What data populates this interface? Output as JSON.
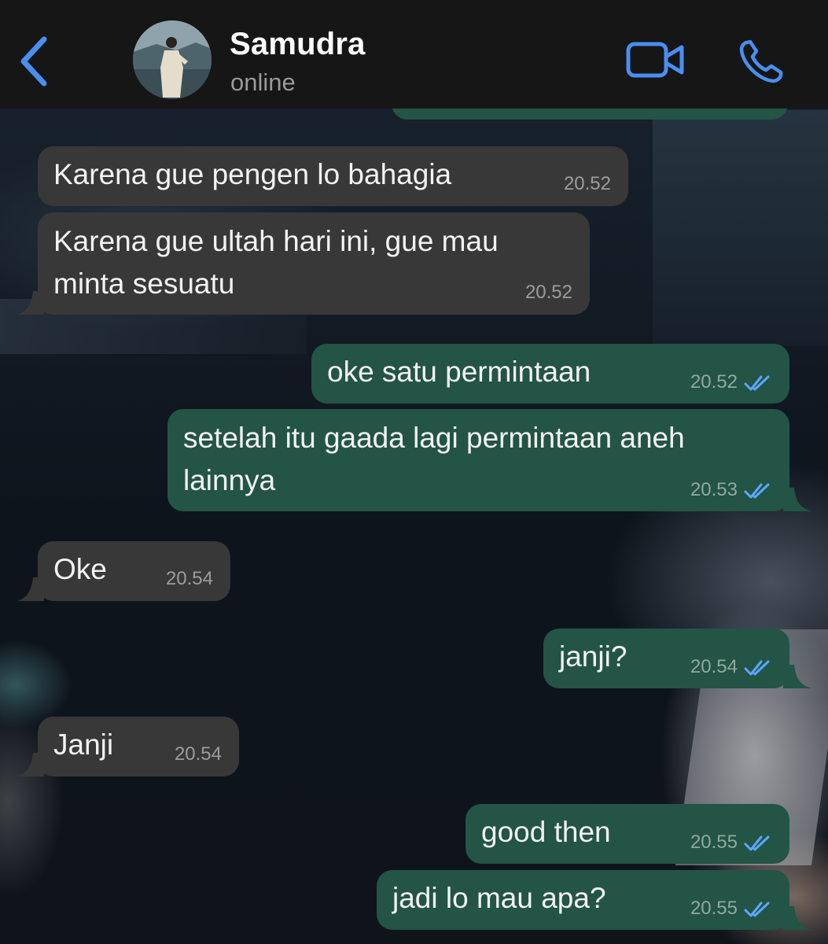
{
  "header": {
    "name": "Samudra",
    "status": "online"
  },
  "colors": {
    "header_bg": "#161616",
    "incoming_bubble": "#383838",
    "outgoing_bubble": "#235445",
    "accent_blue": "#4a8ef0"
  },
  "icons": {
    "back": "chevron-left-icon",
    "video": "video-camera-icon",
    "call": "phone-icon",
    "read": "double-check-icon"
  },
  "messages": [
    {
      "direction": "in",
      "text": "Karena gue pengen lo bahagia",
      "time": "20.52"
    },
    {
      "direction": "in",
      "text": "Karena gue ultah hari ini, gue mau\nminta sesuatu",
      "time": "20.52"
    },
    {
      "direction": "out",
      "text": "oke satu permintaan",
      "time": "20.52",
      "status": "read"
    },
    {
      "direction": "out",
      "text": "setelah itu gaada lagi permintaan aneh\nlainnya",
      "time": "20.53",
      "status": "read"
    },
    {
      "direction": "in",
      "text": "Oke",
      "time": "20.54"
    },
    {
      "direction": "out",
      "text": "janji?",
      "time": "20.54",
      "status": "read"
    },
    {
      "direction": "in",
      "text": "Janji",
      "time": "20.54"
    },
    {
      "direction": "out",
      "text": "good then",
      "time": "20.55",
      "status": "read"
    },
    {
      "direction": "out",
      "text": "jadi lo mau apa?",
      "time": "20.55",
      "status": "read"
    }
  ]
}
